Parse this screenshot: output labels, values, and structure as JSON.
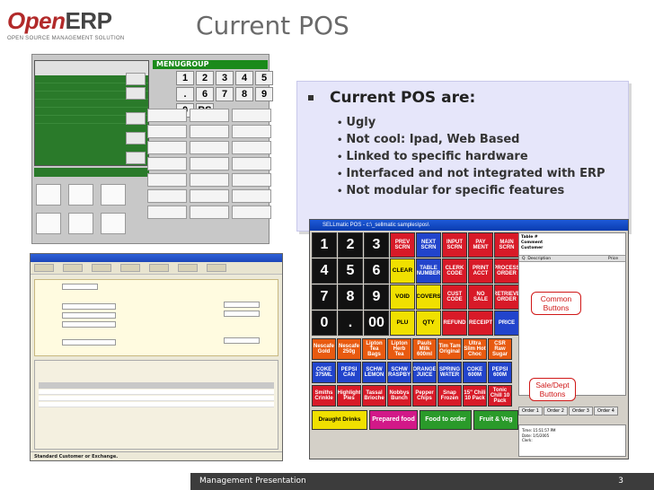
{
  "logo": {
    "word_open": "Open",
    "word_erp": "ERP",
    "tagline": "OPEN SOURCE MANAGEMENT SOLUTION"
  },
  "slide": {
    "title": "Current POS",
    "footer_left": "Management Presentation",
    "page_number": "3"
  },
  "bullets": {
    "heading": "Current POS are:",
    "items": [
      "Ugly",
      "Not cool: Ipad, Web Based",
      "Linked to specific hardware",
      "Interfaced and not integrated with ERP",
      "Not modular for specific features"
    ]
  },
  "shot1": {
    "menu_label": "MENUGROUP",
    "numpad": [
      "1",
      "2",
      "3",
      "4",
      "5",
      ".",
      "6",
      "7",
      "8",
      "9",
      "0",
      "BS"
    ]
  },
  "shot3": {
    "title": "SELLmatic POS - c:\\_sellmatic samples\\pos\\",
    "numpad": [
      "1",
      "2",
      "3",
      "4",
      "5",
      "6",
      "7",
      "8",
      "9",
      "0",
      ".",
      "00"
    ],
    "functions": [
      [
        "PREV SCRN",
        "NEXT SCRN",
        "INPUT SCRN",
        "PAY MENT",
        "MAIN SCRN"
      ],
      [
        "CLEAR",
        "TABLE NUMBER",
        "CLERK CODE",
        "PRINT ACCT",
        "PROCESS ORDER"
      ],
      [
        "VOID",
        "COVERS",
        "CUST CODE",
        "NO SALE",
        "RETRIEVE ORDER"
      ],
      [
        "PLU",
        "QTY",
        "REFUND",
        "RECEIPT",
        "PRICE"
      ]
    ],
    "items_row1": [
      "Nescafe Gold",
      "Nescafe 250g",
      "Lipton Tea Bags",
      "Lipton Herb Tea",
      "Pauls Milk 600ml",
      "Tim Tam Original",
      "Ultra Slim Hot Choc",
      "CSR Raw Sugar"
    ],
    "items_row2": [
      "COKE 375ML",
      "PEPSI CAN",
      "SCHW LEMON",
      "SCHW RASPBY",
      "ORANGE JUICE",
      "SPRING WATER",
      "COKE 600M",
      "PEPSI 600M"
    ],
    "items_row3": [
      "Smiths Crinkle",
      "Highlight Pies",
      "Tassal Brioche",
      "Nobbys Bunch",
      "Pepper Chips",
      "Snap Frozen",
      "15\" Chili 10 Pack",
      "Tonic Chill 10 Pack"
    ],
    "bottom": [
      "Draught Drinks",
      "Prepared food",
      "Food to order",
      "Fruit & Veg"
    ],
    "order_panel": {
      "line1": "Table #",
      "line2": "Comment",
      "line3": "Customer",
      "col_qty": "Q",
      "col_desc": "Description",
      "col_price": "Price"
    },
    "order_tabs": [
      "Order 1",
      "Order 2",
      "Order 3",
      "Order 4"
    ],
    "info": [
      "Time: 15:51:57 PM",
      "Date: 1/5/2005",
      "Clerk:"
    ],
    "callout_common": "Common Buttons",
    "callout_sale": "Sale/Dept Buttons"
  },
  "shot2": {
    "status": "Standard Customer or Exchange."
  }
}
